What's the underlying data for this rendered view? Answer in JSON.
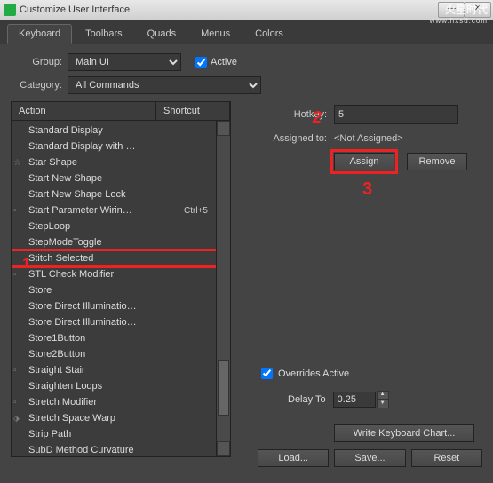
{
  "window": {
    "title": "Customize User Interface"
  },
  "watermark": {
    "line1": "火星时代",
    "line2": "www.hxsd.com"
  },
  "tabs": [
    "Keyboard",
    "Toolbars",
    "Quads",
    "Menus",
    "Colors"
  ],
  "active_tab": 0,
  "group": {
    "label": "Group:",
    "value": "Main UI"
  },
  "active_chk": {
    "label": "Active",
    "checked": true
  },
  "category": {
    "label": "Category:",
    "value": "All Commands"
  },
  "list": {
    "headers": {
      "action": "Action",
      "shortcut": "Shortcut"
    },
    "items": [
      {
        "icon": "",
        "label": "Standard Display",
        "sc": ""
      },
      {
        "icon": "",
        "label": "Standard Display with …",
        "sc": ""
      },
      {
        "icon": "star",
        "label": "Star Shape",
        "sc": ""
      },
      {
        "icon": "",
        "label": "Start New Shape",
        "sc": ""
      },
      {
        "icon": "",
        "label": "Start New Shape Lock",
        "sc": ""
      },
      {
        "icon": "box",
        "label": "Start Parameter Wirin…",
        "sc": "Ctrl+5"
      },
      {
        "icon": "",
        "label": "StepLoop",
        "sc": ""
      },
      {
        "icon": "",
        "label": "StepModeToggle",
        "sc": ""
      },
      {
        "icon": "",
        "label": "Stitch Selected",
        "sc": "",
        "selected": true
      },
      {
        "icon": "box",
        "label": "STL Check Modifier",
        "sc": ""
      },
      {
        "icon": "",
        "label": "Store",
        "sc": ""
      },
      {
        "icon": "",
        "label": "Store Direct Illuminatio…",
        "sc": ""
      },
      {
        "icon": "",
        "label": "Store Direct Illuminatio…",
        "sc": ""
      },
      {
        "icon": "",
        "label": "Store1Button",
        "sc": ""
      },
      {
        "icon": "",
        "label": "Store2Button",
        "sc": ""
      },
      {
        "icon": "box",
        "label": "Straight Stair",
        "sc": ""
      },
      {
        "icon": "",
        "label": "Straighten Loops",
        "sc": ""
      },
      {
        "icon": "box",
        "label": "Stretch Modifier",
        "sc": ""
      },
      {
        "icon": "warp",
        "label": "Stretch Space Warp",
        "sc": ""
      },
      {
        "icon": "",
        "label": "Strip Path",
        "sc": ""
      },
      {
        "icon": "",
        "label": "SubD Method Curvature",
        "sc": ""
      }
    ]
  },
  "right": {
    "hotkey": {
      "label": "Hotkey:",
      "value": "5"
    },
    "assigned": {
      "label": "Assigned to:",
      "value": "<Not Assigned>"
    },
    "assign_btn": "Assign",
    "remove_btn": "Remove"
  },
  "overrides": {
    "label": "Overrides Active",
    "checked": true
  },
  "delay": {
    "label": "Delay To",
    "value": "0.25"
  },
  "write_btn": "Write Keyboard Chart...",
  "load_btn": "Load...",
  "save_btn": "Save...",
  "reset_btn": "Reset"
}
